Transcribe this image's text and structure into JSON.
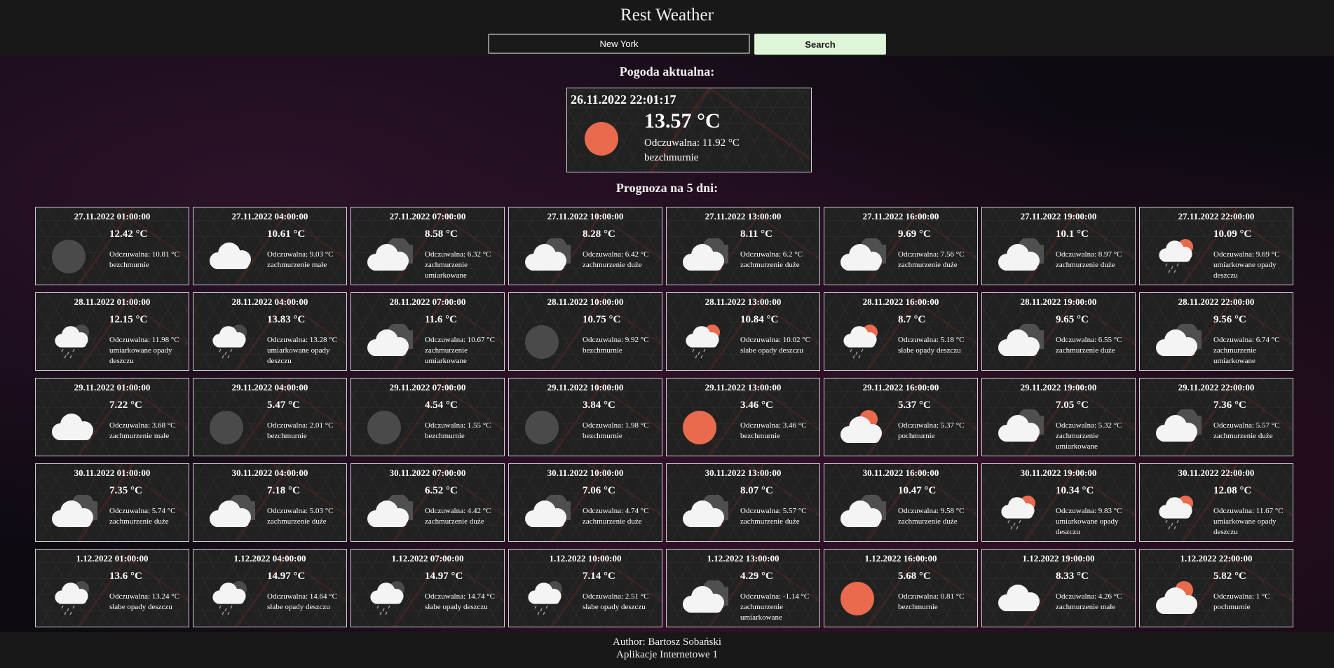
{
  "app": {
    "title": "Rest Weather"
  },
  "search": {
    "value": "New York",
    "button_label": "Search"
  },
  "current": {
    "heading": "Pogoda aktualna:",
    "datetime": "26.11.2022 22:01:17",
    "temp": "13.57 °C",
    "feels": "Odczuwalna: 11.92 °C",
    "desc": "bezchmurnie",
    "icon": "sun-icon",
    "icon_color": "#e96a4d"
  },
  "forecast": {
    "heading": "Prognoza na 5 dni:",
    "items": [
      {
        "date": "27.11.2022 01:00:00",
        "temp": "12.42 °C",
        "feels": "Odczuwalna: 10.81 °C",
        "desc": "bezchmurnie",
        "icon": "moon-icon"
      },
      {
        "date": "27.11.2022 04:00:00",
        "temp": "10.61 °C",
        "feels": "Odczuwalna: 9.03 °C",
        "desc": "zachmurzenie małe",
        "icon": "cloud-icon"
      },
      {
        "date": "27.11.2022 07:00:00",
        "temp": "8.58 °C",
        "feels": "Odczuwalna: 6.32 °C",
        "desc": "zachmurzenie umiarkowane",
        "icon": "cloudy-icon"
      },
      {
        "date": "27.11.2022 10:00:00",
        "temp": "8.28 °C",
        "feels": "Odczuwalna: 6.42 °C",
        "desc": "zachmurzenie duże",
        "icon": "cloudy-icon"
      },
      {
        "date": "27.11.2022 13:00:00",
        "temp": "8.11 °C",
        "feels": "Odczuwalna: 6.2 °C",
        "desc": "zachmurzenie duże",
        "icon": "cloudy-icon"
      },
      {
        "date": "27.11.2022 16:00:00",
        "temp": "9.69 °C",
        "feels": "Odczuwalna: 7.56 °C",
        "desc": "zachmurzenie duże",
        "icon": "cloudy-icon"
      },
      {
        "date": "27.11.2022 19:00:00",
        "temp": "10.1 °C",
        "feels": "Odczuwalna: 8.97 °C",
        "desc": "zachmurzenie duże",
        "icon": "cloudy-icon"
      },
      {
        "date": "27.11.2022 22:00:00",
        "temp": "10.09 °C",
        "feels": "Odczuwalna: 9.69 °C",
        "desc": "umiarkowane opady deszczu",
        "icon": "sun-rain-icon"
      },
      {
        "date": "28.11.2022 01:00:00",
        "temp": "12.15 °C",
        "feels": "Odczuwalna: 11.98 °C",
        "desc": "umiarkowane opady deszczu",
        "icon": "night-rain-icon"
      },
      {
        "date": "28.11.2022 04:00:00",
        "temp": "13.83 °C",
        "feels": "Odczuwalna: 13.28 °C",
        "desc": "umiarkowane opady deszczu",
        "icon": "night-rain-icon"
      },
      {
        "date": "28.11.2022 07:00:00",
        "temp": "11.6 °C",
        "feels": "Odczuwalna: 10.67 °C",
        "desc": "zachmurzenie umiarkowane",
        "icon": "cloudy-icon"
      },
      {
        "date": "28.11.2022 10:00:00",
        "temp": "10.75 °C",
        "feels": "Odczuwalna: 9.92 °C",
        "desc": "bezchmurnie",
        "icon": "moon-icon"
      },
      {
        "date": "28.11.2022 13:00:00",
        "temp": "10.84 °C",
        "feels": "Odczuwalna: 10.02 °C",
        "desc": "słabe opady deszczu",
        "icon": "sun-rain-icon"
      },
      {
        "date": "28.11.2022 16:00:00",
        "temp": "8.7 °C",
        "feels": "Odczuwalna: 5.18 °C",
        "desc": "słabe opady deszczu",
        "icon": "sun-rain-icon"
      },
      {
        "date": "28.11.2022 19:00:00",
        "temp": "9.65 °C",
        "feels": "Odczuwalna: 6.55 °C",
        "desc": "zachmurzenie duże",
        "icon": "cloudy-icon"
      },
      {
        "date": "28.11.2022 22:00:00",
        "temp": "9.56 °C",
        "feels": "Odczuwalna: 6.74 °C",
        "desc": "zachmurzenie umiarkowane",
        "icon": "cloudy-icon"
      },
      {
        "date": "29.11.2022 01:00:00",
        "temp": "7.22 °C",
        "feels": "Odczuwalna: 3.68 °C",
        "desc": "zachmurzenie małe",
        "icon": "cloud-icon"
      },
      {
        "date": "29.11.2022 04:00:00",
        "temp": "5.47 °C",
        "feels": "Odczuwalna: 2.01 °C",
        "desc": "bezchmurnie",
        "icon": "moon-icon"
      },
      {
        "date": "29.11.2022 07:00:00",
        "temp": "4.54 °C",
        "feels": "Odczuwalna: 1.55 °C",
        "desc": "bezchmurnie",
        "icon": "moon-icon"
      },
      {
        "date": "29.11.2022 10:00:00",
        "temp": "3.84 °C",
        "feels": "Odczuwalna: 1.98 °C",
        "desc": "bezchmurnie",
        "icon": "moon-icon"
      },
      {
        "date": "29.11.2022 13:00:00",
        "temp": "3.46 °C",
        "feels": "Odczuwalna: 3.46 °C",
        "desc": "bezchmurnie",
        "icon": "sun-icon"
      },
      {
        "date": "29.11.2022 16:00:00",
        "temp": "5.37 °C",
        "feels": "Odczuwalna: 5.37 °C",
        "desc": "pochmurnie",
        "icon": "sun-cloud-icon"
      },
      {
        "date": "29.11.2022 19:00:00",
        "temp": "7.05 °C",
        "feels": "Odczuwalna: 5.32 °C",
        "desc": "zachmurzenie umiarkowane",
        "icon": "cloudy-icon"
      },
      {
        "date": "29.11.2022 22:00:00",
        "temp": "7.36 °C",
        "feels": "Odczuwalna: 5.57 °C",
        "desc": "zachmurzenie duże",
        "icon": "cloudy-icon"
      },
      {
        "date": "30.11.2022 01:00:00",
        "temp": "7.35 °C",
        "feels": "Odczuwalna: 5.74 °C",
        "desc": "zachmurzenie duże",
        "icon": "cloudy-icon"
      },
      {
        "date": "30.11.2022 04:00:00",
        "temp": "7.18 °C",
        "feels": "Odczuwalna: 5.03 °C",
        "desc": "zachmurzenie duże",
        "icon": "cloudy-icon"
      },
      {
        "date": "30.11.2022 07:00:00",
        "temp": "6.52 °C",
        "feels": "Odczuwalna: 4.42 °C",
        "desc": "zachmurzenie duże",
        "icon": "cloudy-icon"
      },
      {
        "date": "30.11.2022 10:00:00",
        "temp": "7.06 °C",
        "feels": "Odczuwalna: 4.74 °C",
        "desc": "zachmurzenie duże",
        "icon": "cloudy-icon"
      },
      {
        "date": "30.11.2022 13:00:00",
        "temp": "8.07 °C",
        "feels": "Odczuwalna: 5.57 °C",
        "desc": "zachmurzenie duże",
        "icon": "cloudy-icon"
      },
      {
        "date": "30.11.2022 16:00:00",
        "temp": "10.47 °C",
        "feels": "Odczuwalna: 9.58 °C",
        "desc": "zachmurzenie duże",
        "icon": "cloudy-icon"
      },
      {
        "date": "30.11.2022 19:00:00",
        "temp": "10.34 °C",
        "feels": "Odczuwalna: 9.83 °C",
        "desc": "umiarkowane opady deszczu",
        "icon": "sun-rain-icon"
      },
      {
        "date": "30.11.2022 22:00:00",
        "temp": "12.08 °C",
        "feels": "Odczuwalna: 11.67 °C",
        "desc": "umiarkowane opady deszczu",
        "icon": "sun-rain-icon"
      },
      {
        "date": "1.12.2022 01:00:00",
        "temp": "13.6 °C",
        "feels": "Odczuwalna: 13.24 °C",
        "desc": "słabe opady deszczu",
        "icon": "night-rain-icon"
      },
      {
        "date": "1.12.2022 04:00:00",
        "temp": "14.97 °C",
        "feels": "Odczuwalna: 14.64 °C",
        "desc": "słabe opady deszczu",
        "icon": "night-rain-icon"
      },
      {
        "date": "1.12.2022 07:00:00",
        "temp": "14.97 °C",
        "feels": "Odczuwalna: 14.74 °C",
        "desc": "słabe opady deszczu",
        "icon": "night-rain-icon"
      },
      {
        "date": "1.12.2022 10:00:00",
        "temp": "7.14 °C",
        "feels": "Odczuwalna: 2.51 °C",
        "desc": "słabe opady deszczu",
        "icon": "night-rain-icon"
      },
      {
        "date": "1.12.2022 13:00:00",
        "temp": "4.29 °C",
        "feels": "Odczuwalna: -1.14 °C",
        "desc": "zachmurzenie umiarkowane",
        "icon": "cloudy-icon"
      },
      {
        "date": "1.12.2022 16:00:00",
        "temp": "5.68 °C",
        "feels": "Odczuwalna: 0.81 °C",
        "desc": "bezchmurnie",
        "icon": "sun-icon"
      },
      {
        "date": "1.12.2022 19:00:00",
        "temp": "8.33 °C",
        "feels": "Odczuwalna: 4.26 °C",
        "desc": "zachmurzenie małe",
        "icon": "cloud-icon"
      },
      {
        "date": "1.12.2022 22:00:00",
        "temp": "5.82 °C",
        "feels": "Odczuwalna: 1 °C",
        "desc": "pochmurnie",
        "icon": "sun-cloud-icon"
      }
    ]
  },
  "footer": {
    "author": "Author: Bartosz Sobański",
    "course": "Aplikacje Internetowe 1"
  },
  "colors": {
    "sun": "#e96a4d",
    "moon": "#4a4a4a",
    "cloud": "#f4f4f4",
    "cloud_dark": "#4f4f4f",
    "rain": "#9a9a9a"
  }
}
